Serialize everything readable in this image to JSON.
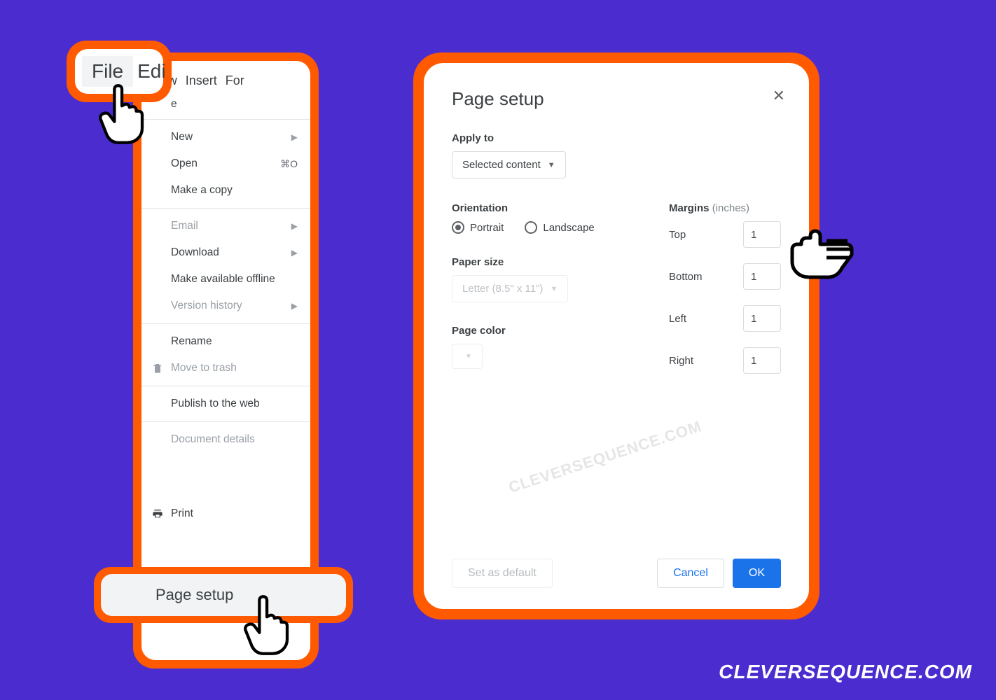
{
  "menubar": {
    "file": "File",
    "edit": "Edi",
    "view": "View",
    "insert": "Insert",
    "format": "For"
  },
  "file_menu": {
    "trailing_e": "e",
    "new": "New",
    "open": "Open",
    "open_shortcut": "⌘O",
    "make_copy": "Make a copy",
    "email": "Email",
    "download": "Download",
    "offline": "Make available offline",
    "version_history": "Version history",
    "rename": "Rename",
    "move_trash": "Move to trash",
    "publish": "Publish to the web",
    "doc_details": "Document details",
    "page_setup": "Page setup",
    "print": "Print"
  },
  "dialog": {
    "title": "Page setup",
    "apply_to_label": "Apply to",
    "apply_to_value": "Selected content",
    "orientation_label": "Orientation",
    "portrait": "Portrait",
    "landscape": "Landscape",
    "paper_size_label": "Paper size",
    "paper_size_value": "Letter (8.5\" x 11\")",
    "page_color_label": "Page color",
    "margins_label": "Margins",
    "margins_unit": "(inches)",
    "margins": {
      "top_label": "Top",
      "top": "1",
      "bottom_label": "Bottom",
      "bottom": "1",
      "left_label": "Left",
      "left": "1",
      "right_label": "Right",
      "right": "1"
    },
    "set_default": "Set as default",
    "cancel": "Cancel",
    "ok": "OK"
  },
  "watermark": "CLEVERSEQUENCE.COM",
  "credit": "CLEVERSEQUENCE.COM"
}
